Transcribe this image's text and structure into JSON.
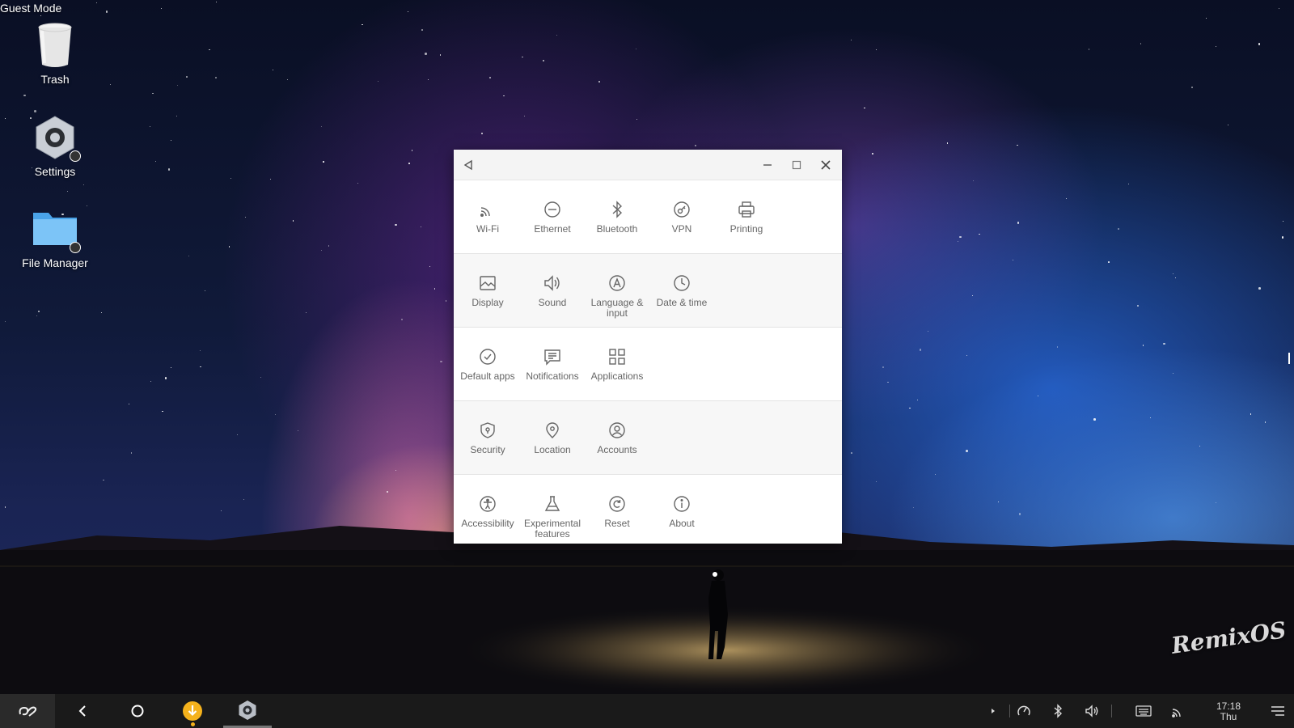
{
  "desktop": {
    "mode_label": "Guest Mode",
    "icons": [
      {
        "label": "Trash",
        "icon": "trash-icon"
      },
      {
        "label": "Settings",
        "icon": "settings-gear-icon"
      },
      {
        "label": "File Manager",
        "icon": "folder-icon"
      }
    ],
    "watermark": "RemixOS"
  },
  "settings_window": {
    "rows": [
      {
        "items": [
          {
            "label": "Wi-Fi",
            "icon": "wifi-icon"
          },
          {
            "label": "Ethernet",
            "icon": "ethernet-icon"
          },
          {
            "label": "Bluetooth",
            "icon": "bluetooth-icon"
          },
          {
            "label": "VPN",
            "icon": "vpn-icon"
          },
          {
            "label": "Printing",
            "icon": "printer-icon"
          }
        ]
      },
      {
        "items": [
          {
            "label": "Display",
            "icon": "display-icon"
          },
          {
            "label": "Sound",
            "icon": "sound-icon"
          },
          {
            "label": "Language &\ninput",
            "icon": "language-icon"
          },
          {
            "label": "Date & time",
            "icon": "clock-icon"
          }
        ]
      },
      {
        "items": [
          {
            "label": "Default apps",
            "icon": "check-circle-icon"
          },
          {
            "label": "Notifications",
            "icon": "notifications-icon"
          },
          {
            "label": "Applications",
            "icon": "apps-grid-icon"
          }
        ]
      },
      {
        "items": [
          {
            "label": "Security",
            "icon": "shield-icon"
          },
          {
            "label": "Location",
            "icon": "location-pin-icon"
          },
          {
            "label": "Accounts",
            "icon": "account-icon"
          }
        ]
      },
      {
        "items": [
          {
            "label": "Accessibility",
            "icon": "accessibility-icon"
          },
          {
            "label": "Experimental\nfeatures",
            "icon": "flask-icon"
          },
          {
            "label": "Reset",
            "icon": "reset-icon"
          },
          {
            "label": "About",
            "icon": "info-icon"
          }
        ]
      }
    ]
  },
  "taskbar": {
    "clock_time": "17:18",
    "clock_day": "Thu"
  }
}
